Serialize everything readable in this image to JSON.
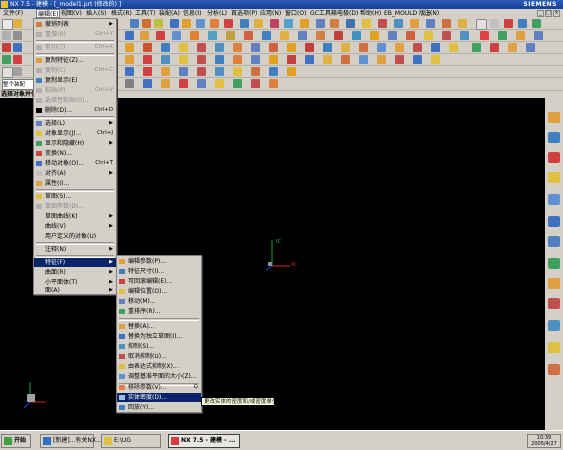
{
  "window": {
    "title": "NX 7.5 - 建模 - [_model1.prt (修改的) ]",
    "brand": "SIEMENS"
  },
  "menubar": {
    "items": [
      "文件(F)",
      "编辑(E)",
      "视图(V)",
      "插入(S)",
      "格式(R)",
      "工具(T)",
      "装配(A)",
      "信息(I)",
      "分析(L)",
      "首选项(P)",
      "应用(N)",
      "窗口(O)",
      "GC工具箱",
      "电极(D)",
      "帮助(H)",
      "EB_MOULD 版.6",
      "注(N)"
    ]
  },
  "selection_bar": {
    "prompt": "选择对象并使"
  },
  "status_hint": "整个装配",
  "edit_menu": {
    "items": [
      {
        "label": "撤销列表",
        "shortcut": "",
        "icon": "undo-list-icon",
        "disabled": false,
        "submenu": true
      },
      {
        "label": "重做(R)",
        "shortcut": "Ctrl+Y",
        "icon": "redo-icon",
        "disabled": true,
        "submenu": false
      },
      {
        "label": "剪切(T)",
        "shortcut": "Ctrl+X",
        "icon": "cut-icon",
        "disabled": true,
        "submenu": false
      },
      {
        "label": "复制特征(Z)...",
        "shortcut": "",
        "icon": "copy-feature-icon",
        "disabled": false,
        "submenu": false
      },
      {
        "label": "复制(C)",
        "shortcut": "Ctrl+C",
        "icon": "copy-icon",
        "disabled": true,
        "submenu": false
      },
      {
        "label": "复制显示(E)",
        "shortcut": "",
        "icon": "copy-display-icon",
        "disabled": false,
        "submenu": false
      },
      {
        "label": "粘贴(P)",
        "shortcut": "Ctrl+V",
        "icon": "paste-icon",
        "disabled": true,
        "submenu": false
      },
      {
        "label": "选择性粘贴(O)...",
        "shortcut": "",
        "icon": "paste-special-icon",
        "disabled": true,
        "submenu": false
      },
      {
        "label": "删除(D)...",
        "shortcut": "Ctrl+D",
        "icon": "delete-icon",
        "disabled": false,
        "submenu": false
      },
      {
        "label": "选择(L)",
        "shortcut": "",
        "icon": "select-icon",
        "disabled": false,
        "submenu": true
      },
      {
        "label": "对象显示(J)...",
        "shortcut": "Ctrl+J",
        "icon": "object-display-icon",
        "disabled": false,
        "submenu": false
      },
      {
        "label": "显示和隐藏(H)",
        "shortcut": "",
        "icon": "show-hide-icon",
        "disabled": false,
        "submenu": true
      },
      {
        "label": "变换(N)...",
        "shortcut": "",
        "icon": "transform-icon",
        "disabled": false,
        "submenu": false
      },
      {
        "label": "移动对象(O)...",
        "shortcut": "Ctrl+T",
        "icon": "move-object-icon",
        "disabled": false,
        "submenu": false
      },
      {
        "label": "对齐(A)",
        "shortcut": "",
        "icon": "align-icon",
        "disabled": false,
        "submenu": true
      },
      {
        "label": "属性(I)...",
        "shortcut": "",
        "icon": "properties-icon",
        "disabled": false,
        "submenu": false
      },
      {
        "label": "草图(S)...",
        "shortcut": "",
        "icon": "sketch-icon",
        "disabled": false,
        "submenu": false
      },
      {
        "label": "草图参数(D)...",
        "shortcut": "",
        "icon": "sketch-params-icon",
        "disabled": true,
        "submenu": false
      },
      {
        "label": "草图曲线(K)",
        "shortcut": "",
        "icon": "sketch-curve-icon",
        "disabled": false,
        "submenu": true
      },
      {
        "label": "曲线(V)",
        "shortcut": "",
        "icon": "curve-icon",
        "disabled": false,
        "submenu": true
      },
      {
        "label": "用户定义的对象(U)",
        "shortcut": "",
        "icon": "user-defined-icon",
        "disabled": false,
        "submenu": false
      },
      {
        "label": "注释(N)",
        "shortcut": "",
        "icon": "annotation-icon",
        "disabled": false,
        "submenu": true
      },
      {
        "label": "特征(F)",
        "shortcut": "",
        "icon": "feature-icon",
        "disabled": false,
        "submenu": true,
        "highlighted": true
      },
      {
        "label": "曲面(R)",
        "shortcut": "",
        "icon": "surface-icon",
        "disabled": false,
        "submenu": true
      },
      {
        "label": "小平面体(T)",
        "shortcut": "",
        "icon": "facet-body-icon",
        "disabled": false,
        "submenu": true
      },
      {
        "label": "面(A)",
        "shortcut": "",
        "icon": "face-icon",
        "disabled": false,
        "submenu": true
      }
    ]
  },
  "feature_submenu": {
    "items": [
      {
        "label": "编辑参数(P)...",
        "shortcut": "",
        "icon": "edit-params-icon",
        "submenu": false
      },
      {
        "label": "特征尺寸(I)...",
        "shortcut": "",
        "icon": "feature-dim-icon",
        "submenu": false
      },
      {
        "label": "可回滚编辑(E)...",
        "shortcut": "",
        "icon": "rollback-edit-icon",
        "submenu": false
      },
      {
        "label": "编辑位置(O)...",
        "shortcut": "",
        "icon": "edit-position-icon",
        "submenu": false
      },
      {
        "label": "移动(M)...",
        "shortcut": "",
        "icon": "move-icon",
        "submenu": false
      },
      {
        "label": "重排序(R)...",
        "shortcut": "",
        "icon": "reorder-icon",
        "submenu": false
      },
      {
        "label": "替换(A)...",
        "shortcut": "",
        "icon": "replace-icon",
        "submenu": false
      },
      {
        "label": "替换为独立草图(I)...",
        "shortcut": "",
        "icon": "replace-sketch-icon",
        "submenu": false
      },
      {
        "label": "抑制(S)...",
        "shortcut": "",
        "icon": "suppress-icon",
        "submenu": false
      },
      {
        "label": "取消抑制(U)...",
        "shortcut": "",
        "icon": "unsuppress-icon",
        "submenu": false
      },
      {
        "label": "由表达式抑制(X)...",
        "shortcut": "",
        "icon": "suppress-expr-icon",
        "submenu": false
      },
      {
        "label": "调整基准平面的大小(Z)...",
        "shortcut": "",
        "icon": "resize-datum-icon",
        "submenu": false
      },
      {
        "label": "移除参数(V)...",
        "shortcut": "Q",
        "icon": "remove-params-icon",
        "submenu": false
      },
      {
        "label": "实体密度(D)...",
        "shortcut": "",
        "icon": "solid-density-icon",
        "submenu": false,
        "highlighted": true
      },
      {
        "label": "回放(Y)...",
        "shortcut": "",
        "icon": "playback-icon",
        "submenu": false
      }
    ]
  },
  "tooltip": "更改实体的密度和/或密度单位。",
  "axes": {
    "x": "XC",
    "y": "YC"
  },
  "taskbar": {
    "start": "开始",
    "buttons": [
      "[新建]...有关NX...",
      "E:\\UG",
      "NX 7.5 - 建模 - ..."
    ],
    "clock_time": "10:39",
    "clock_date": "2005/4/27"
  },
  "colors": {
    "menu_highlight": "#0a246a",
    "titlebar": "#2b5db8",
    "xc_axis": "#d42020",
    "yc_axis": "#20a040",
    "zc_axis": "#2040d0"
  }
}
